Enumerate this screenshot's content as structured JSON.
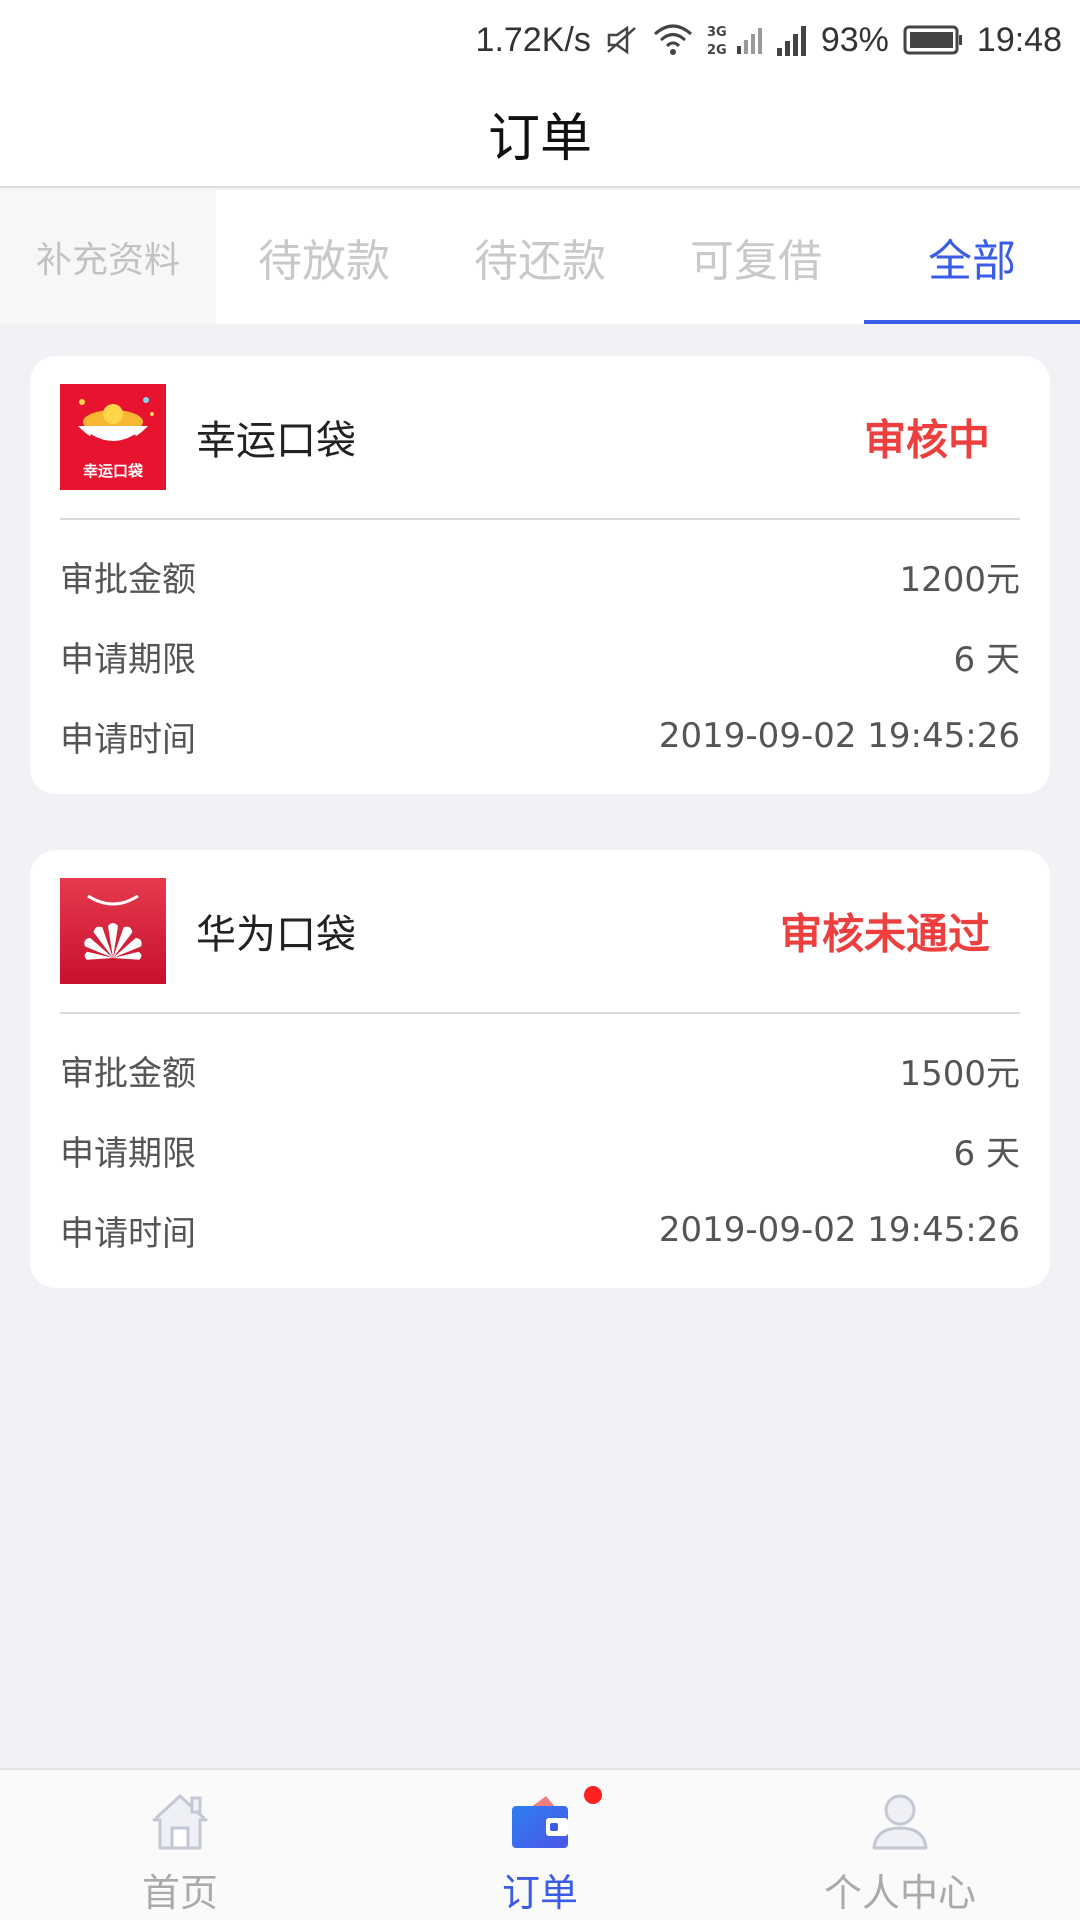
{
  "status_bar": {
    "speed": "1.72K/s",
    "network": "3G 2G",
    "battery": "93%",
    "time": "19:48"
  },
  "header": {
    "title": "订单"
  },
  "tabs": [
    {
      "label": "补充资料"
    },
    {
      "label": "待放款"
    },
    {
      "label": "待还款"
    },
    {
      "label": "可复借"
    },
    {
      "label": "全部"
    }
  ],
  "orders": [
    {
      "app_name": "幸运口袋",
      "logo_text": "幸运口袋",
      "status": "审核中",
      "status_color": "#ee3f3f",
      "rows": [
        {
          "label": "审批金额",
          "value": "1200元"
        },
        {
          "label": "申请期限",
          "value": "6 天"
        },
        {
          "label": "申请时间",
          "value": "2019-09-02 19:45:26"
        }
      ]
    },
    {
      "app_name": "华为口袋",
      "status": "审核未通过",
      "status_color": "#ee3f3f",
      "rows": [
        {
          "label": "审批金额",
          "value": "1500元"
        },
        {
          "label": "申请期限",
          "value": "6 天"
        },
        {
          "label": "申请时间",
          "value": "2019-09-02 19:45:26"
        }
      ]
    }
  ],
  "bottom_nav": [
    {
      "label": "首页",
      "icon": "home-icon"
    },
    {
      "label": "订单",
      "icon": "wallet-icon"
    },
    {
      "label": "个人中心",
      "icon": "user-icon"
    }
  ],
  "colors": {
    "accent": "#3b5ce6",
    "status_red": "#ee3f3f",
    "background": "#f1f1f6"
  }
}
